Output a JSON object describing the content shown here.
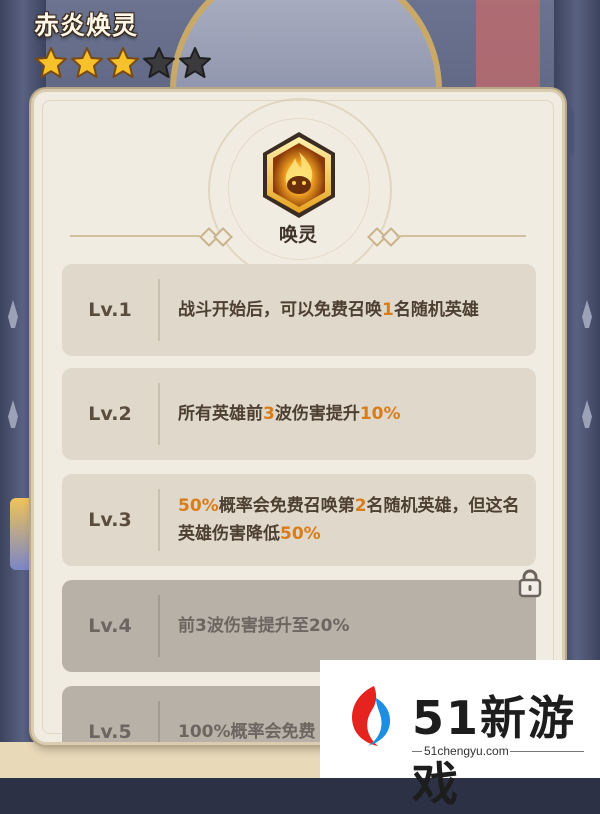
{
  "hero": {
    "name": "赤炎焕灵",
    "stars_filled": 3,
    "stars_total": 5
  },
  "skill": {
    "title": "唤灵"
  },
  "levels": [
    {
      "label": "Lv.1",
      "locked": false,
      "parts": [
        [
          "战斗开始后，可以免费召唤",
          false
        ],
        [
          "1",
          true
        ],
        [
          "名随机英雄",
          false
        ]
      ]
    },
    {
      "label": "Lv.2",
      "locked": false,
      "parts": [
        [
          "所有英雄前",
          false
        ],
        [
          "3",
          true
        ],
        [
          "波伤害提升",
          false
        ],
        [
          "10%",
          true
        ]
      ]
    },
    {
      "label": "Lv.3",
      "locked": false,
      "parts": [
        [
          "50%",
          true
        ],
        [
          "概率会免费召唤第",
          false
        ],
        [
          "2",
          true
        ],
        [
          "名随机英雄，但这名英雄伤害降低",
          false
        ],
        [
          "50%",
          true
        ]
      ]
    },
    {
      "label": "Lv.4",
      "locked": true,
      "parts": [
        [
          "前3波伤害提升至20%",
          false
        ]
      ]
    },
    {
      "label": "Lv.5",
      "locked": true,
      "parts": [
        [
          "100%概率会免费",
          false
        ]
      ]
    }
  ],
  "watermark": {
    "brand": "51新游戏",
    "url": "51chengyu.com"
  },
  "colors": {
    "highlight": "#d87d1a",
    "panel": "#f1ece2",
    "row": "#dfd8cb",
    "locked_row": "#b8b1a8"
  },
  "icons": {
    "star": "star-icon",
    "lock": "lock-icon",
    "skill": "fire-spirit-icon"
  }
}
